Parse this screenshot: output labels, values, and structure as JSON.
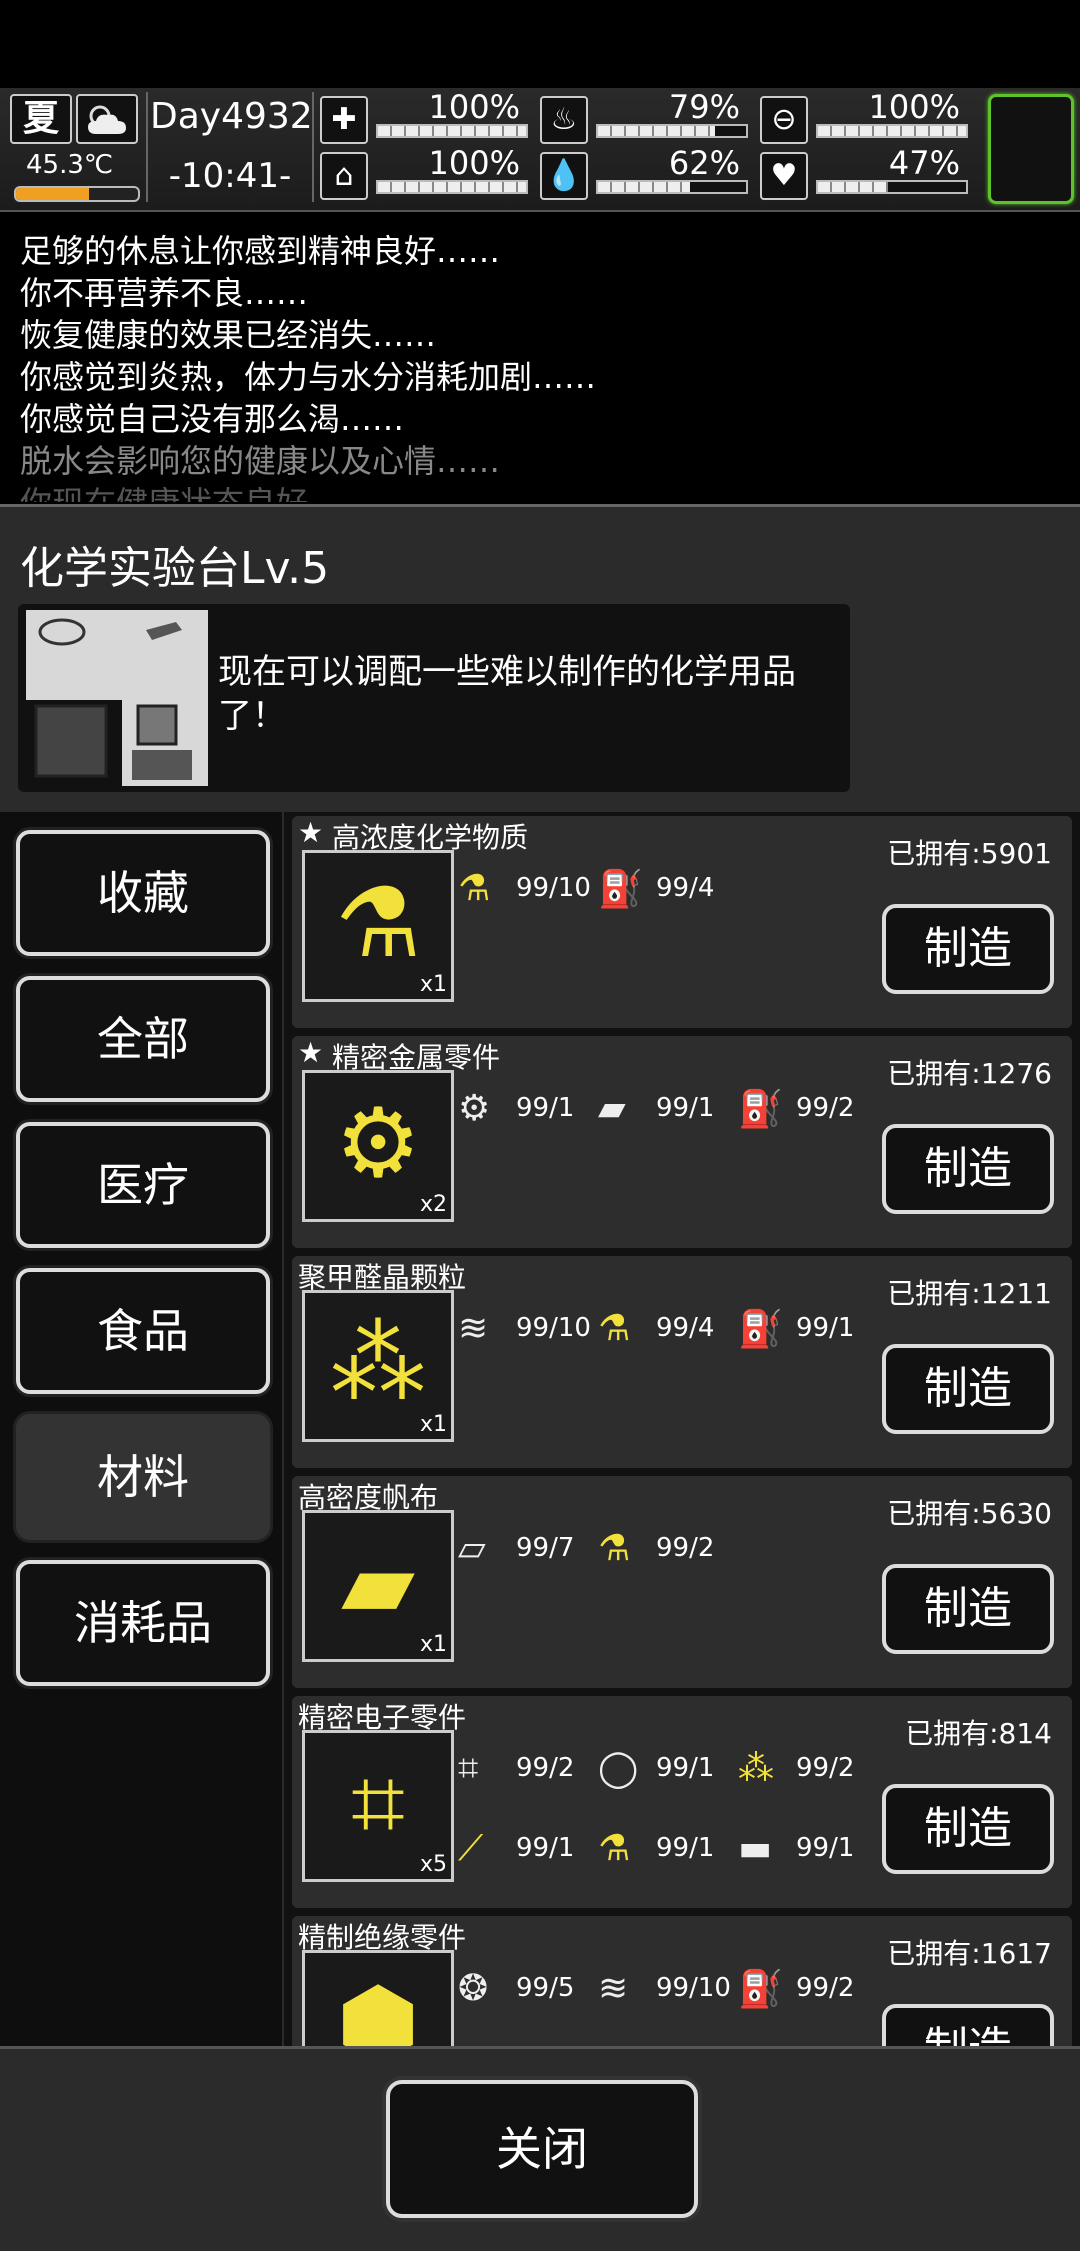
{
  "hud": {
    "season": "夏",
    "temperature": "45.3℃",
    "temperature_level": 0.6,
    "day": "Day4932",
    "time": "-10:41-",
    "stats": [
      {
        "icon": "medkit-icon",
        "value": "100%",
        "level": 1.0
      },
      {
        "icon": "stomach-icon",
        "value": "79%",
        "level": 0.79
      },
      {
        "icon": "pill-icon",
        "value": "100%",
        "level": 1.0
      },
      {
        "icon": "boot-icon",
        "value": "100%",
        "level": 1.0
      },
      {
        "icon": "water-drop-icon",
        "value": "62%",
        "level": 0.62
      },
      {
        "icon": "heart-icon",
        "value": "47%",
        "level": 0.47
      }
    ]
  },
  "log": [
    "足够的休息让你感到精神良好……",
    "你不再营养不良……",
    "恢复健康的效果已经消失……",
    "你感觉到炎热，体力与水分消耗加剧……",
    "你感觉自己没有那么渴……",
    "脱水会影响您的健康以及心情……",
    "你现在健康状态良好……"
  ],
  "station": {
    "title": "化学实验台Lv.5",
    "description": "现在可以调配一些难以制作的化学用品了！"
  },
  "tabs": [
    "收藏",
    "全部",
    "医疗",
    "食品",
    "材料",
    "消耗品"
  ],
  "active_tab": "材料",
  "recipes": [
    {
      "name": "高浓度化学物质",
      "favorite": true,
      "qty": "x1",
      "owned": "已拥有:5901",
      "button": "制造",
      "materials": [
        [
          "flask-icon",
          "99/10"
        ],
        [
          "canister-icon",
          "99/4"
        ]
      ]
    },
    {
      "name": "精密金属零件",
      "favorite": true,
      "qty": "x2",
      "owned": "已拥有:1276",
      "button": "制造",
      "materials": [
        [
          "gears-icon",
          "99/1"
        ],
        [
          "scrap-icon",
          "99/1"
        ],
        [
          "canister-icon",
          "99/2"
        ]
      ]
    },
    {
      "name": "聚甲醛晶颗粒",
      "favorite": false,
      "qty": "x1",
      "owned": "已拥有:1211",
      "button": "制造",
      "materials": [
        [
          "fabric-roll-icon",
          "99/10"
        ],
        [
          "flask-icon",
          "99/4"
        ],
        [
          "canister-icon",
          "99/1"
        ]
      ]
    },
    {
      "name": "高密度帆布",
      "favorite": false,
      "qty": "x1",
      "owned": "已拥有:5630",
      "button": "制造",
      "materials": [
        [
          "cloth-icon",
          "99/7"
        ],
        [
          "flask-icon",
          "99/2"
        ]
      ]
    },
    {
      "name": "精密电子零件",
      "favorite": false,
      "qty": "x5",
      "owned": "已拥有:814",
      "button": "制造",
      "materials": [
        [
          "circuit-icon",
          "99/2"
        ],
        [
          "ring-icon",
          "99/1"
        ],
        [
          "granules-icon",
          "99/2"
        ],
        [
          "wire-icon",
          "99/1"
        ],
        [
          "flask-icon",
          "99/1"
        ],
        [
          "metal-bar-icon",
          "99/1"
        ]
      ]
    },
    {
      "name": "精制绝缘零件",
      "favorite": false,
      "qty": "",
      "owned": "已拥有:1617",
      "button": "制造",
      "materials": [
        [
          "pebbles-icon",
          "99/5"
        ],
        [
          "fabric-roll-icon",
          "99/10"
        ],
        [
          "canister-icon",
          "99/2"
        ]
      ]
    }
  ],
  "close_button": "关闭"
}
